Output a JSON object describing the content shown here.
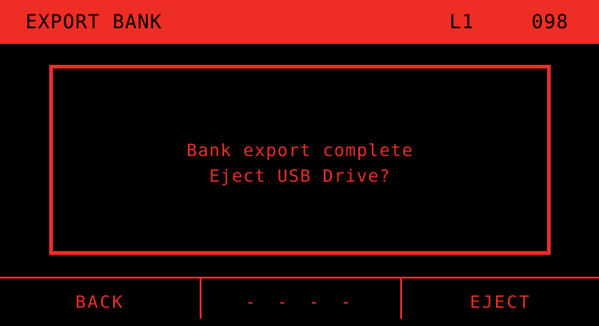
{
  "colors": {
    "accent": "#ee2e24",
    "background": "#000000",
    "header_text": "#000000"
  },
  "header": {
    "title": "EXPORT BANK",
    "layer": "L1",
    "number": "098"
  },
  "dialog": {
    "line1": "Bank export complete",
    "line2": "Eject USB Drive?"
  },
  "softkeys": [
    {
      "label": "BACK"
    },
    {
      "label": "- - - -"
    },
    {
      "label": "EJECT"
    }
  ]
}
